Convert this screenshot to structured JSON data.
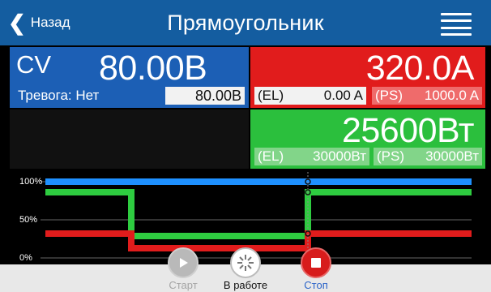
{
  "header": {
    "back_label": "Назад",
    "title": "Прямоугольник",
    "back_icon": "chevron-left-icon",
    "menu_icon": "hamburger-menu-icon"
  },
  "voltage": {
    "mode": "CV",
    "value": "80.00В",
    "alarm": "Тревога: Нет",
    "set_value": "80.00В"
  },
  "current": {
    "value": "320.0A",
    "el_tag": "(EL)",
    "el_value": "0.00 A",
    "ps_tag": "(PS)",
    "ps_value": "1000.0 A"
  },
  "power": {
    "value": "25600Вт",
    "el_tag": "(EL)",
    "el_value": "30000Вт",
    "ps_tag": "(PS)",
    "ps_value": "30000Вт"
  },
  "graph": {
    "labels": [
      "100%",
      "50%",
      "0%"
    ],
    "series": [
      {
        "color": "#1E90FF",
        "level": 1.0
      },
      {
        "color": "#2ecc40",
        "pattern": "high-low-high"
      },
      {
        "color": "#e11c1c",
        "pattern": "mid-low-mid"
      }
    ]
  },
  "controls": {
    "start": "Старт",
    "running": "В работе",
    "stop": "Стоп"
  },
  "colors": {
    "header": "#145da0",
    "voltage": "#1c5fb5",
    "current": "#e11c1c",
    "power": "#2bbf3d"
  }
}
